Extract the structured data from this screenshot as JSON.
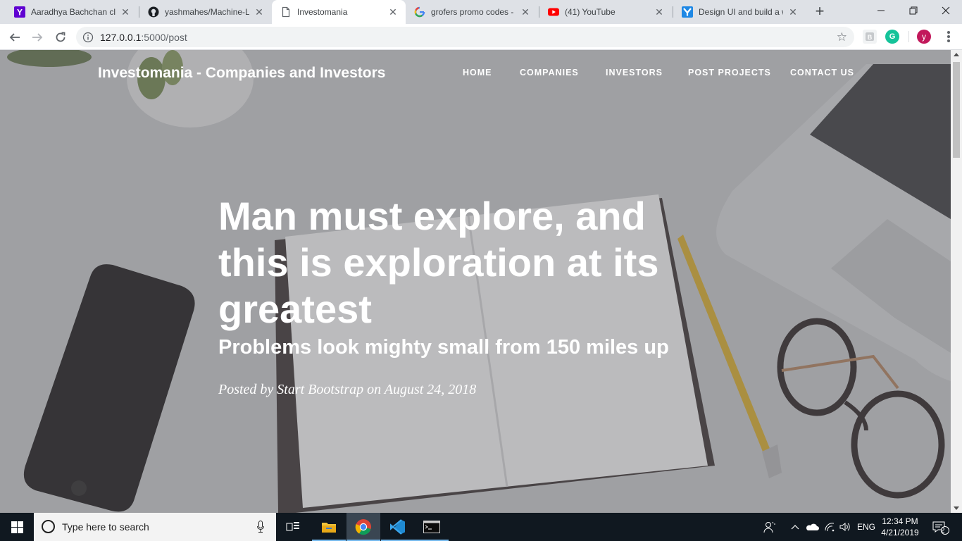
{
  "browser": {
    "tabs": [
      {
        "title": "Aaradhya Bachchan clic",
        "favicon": "yahoo-icon",
        "active": false
      },
      {
        "title": "yashmahes/Machine-Le",
        "favicon": "github-icon",
        "active": false
      },
      {
        "title": "Investomania",
        "favicon": "page-icon",
        "active": true
      },
      {
        "title": "grofers promo codes - C",
        "favicon": "google-icon",
        "active": false
      },
      {
        "title": "(41) YouTube",
        "favicon": "youtube-icon",
        "active": false
      },
      {
        "title": "Design UI and build a w",
        "favicon": "yatra-icon",
        "active": false
      }
    ],
    "url_host": "127.0.0.1",
    "url_path": ":5000/post",
    "profile_initial": "y",
    "colors": {
      "tabstrip": "#dee1e6",
      "active_tab": "#ffffff",
      "profile": "#c2185b",
      "grammarly": "#15c39a"
    }
  },
  "site": {
    "brand": "Investomania - Companies and Investors",
    "nav": [
      "HOME",
      "COMPANIES",
      "INVESTORS",
      "POST PROJECTS",
      "CONTACT US"
    ]
  },
  "post": {
    "heading": "Man must explore, and this is exploration at its greatest",
    "subheading": "Problems look mighty small from 150 miles up",
    "meta": "Posted by Start Bootstrap on August 24, 2018"
  },
  "taskbar": {
    "search_placeholder": "Type here to search",
    "language": "ENG",
    "time": "12:34 PM",
    "date": "4/21/2019",
    "notification_count": "2",
    "colors": {
      "background": "#101820",
      "active": "#3a4652",
      "accent": "#76b9ed"
    }
  }
}
